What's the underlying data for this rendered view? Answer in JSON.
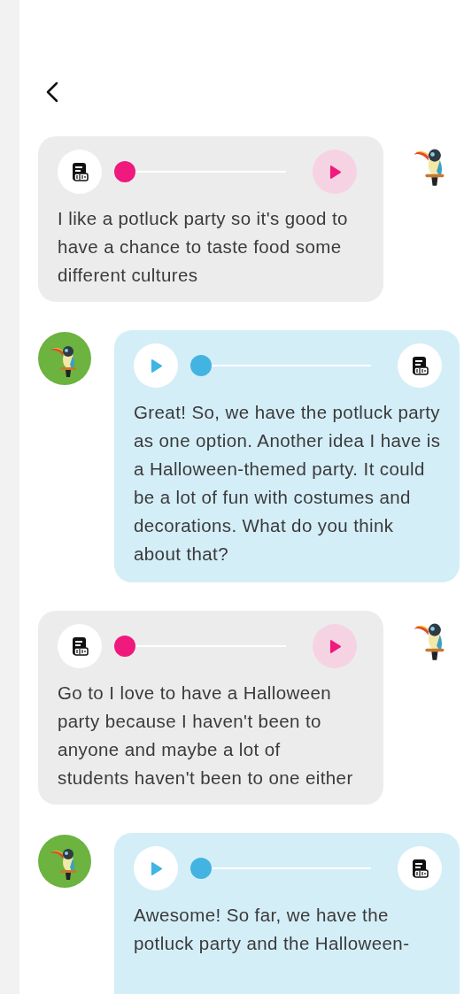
{
  "messages": [
    {
      "kind": "user",
      "level": 0,
      "text": "I like a potluck party so it's good to have a chance to taste food some different cultures"
    },
    {
      "kind": "bot",
      "level": 0,
      "text": "Great! So, we have the potluck party as one option. Another idea I have is a Halloween-themed party. It could be a lot of fun with costumes and decorations. What do you think about that?"
    },
    {
      "kind": "user",
      "level": 0,
      "text": "Go to I love to have a Halloween party because I haven't been to anyone and maybe a lot of students haven't been to one either"
    },
    {
      "kind": "bot",
      "level": 0,
      "text": "Awesome! So far, we have the potluck party and the Halloween-"
    }
  ]
}
